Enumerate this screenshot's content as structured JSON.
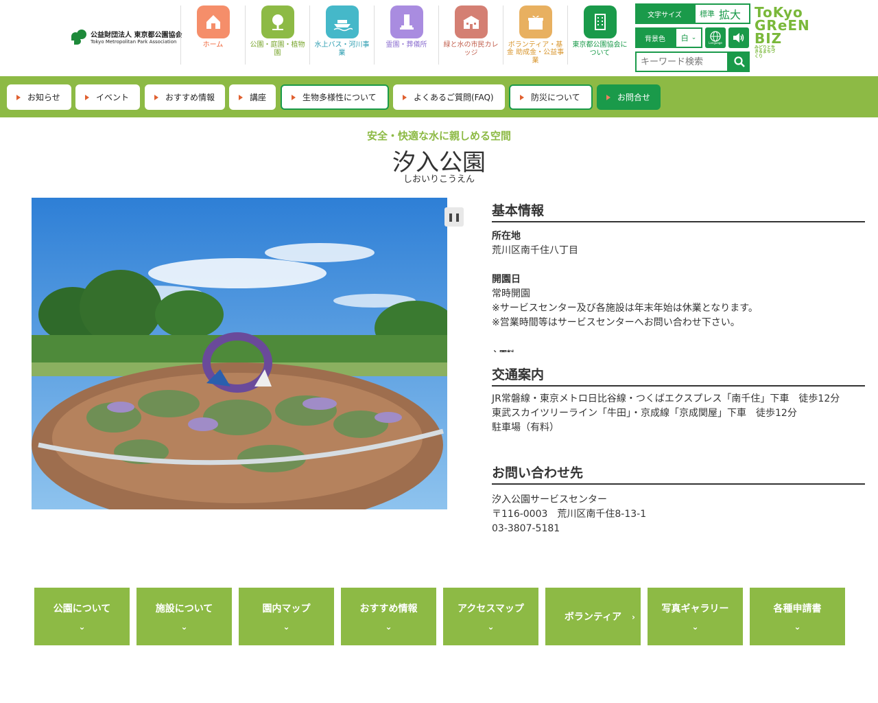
{
  "header": {
    "logo_line1": "公益財団法人 東京都公園協会",
    "logo_line2": "Tokyo Metropolitan Park Association",
    "nav": [
      {
        "label": "ホーム",
        "color": "#f58e6a",
        "text_color": "#f0683c",
        "icon": "home-icon"
      },
      {
        "label": "公園・庭園・植物園",
        "color": "#8dba45",
        "text_color": "#7aa62f",
        "icon": "tree-icon"
      },
      {
        "label": "水上バス・河川事業",
        "color": "#45b8c9",
        "text_color": "#2a9cb0",
        "icon": "boat-icon"
      },
      {
        "label": "霊園・葬儀所",
        "color": "#a98ce0",
        "text_color": "#8c6fd0",
        "icon": "monument-icon"
      },
      {
        "label": "緑と水の市民カレッジ",
        "color": "#d47f73",
        "text_color": "#c2604f",
        "icon": "school-icon"
      },
      {
        "label": "ボランティア・基金 助成金・公益事業",
        "color": "#e8b060",
        "text_color": "#d8952c",
        "icon": "gift-icon"
      },
      {
        "label": "東京都公園協会について",
        "color": "#1a9a4a",
        "text_color": "#1a9a4a",
        "icon": "building-icon"
      }
    ],
    "font_size_label": "文字サイズ",
    "font_size_standard": "標準",
    "font_size_large": "拡大",
    "bg_color_label": "背景色",
    "bg_color_value": "白",
    "language_label": "Language",
    "search_placeholder": "キーワード検索",
    "tgb_line1": "ToKyo",
    "tgb_line2": "GReEN",
    "tgb_line3": "BIZ",
    "tgb_small": "みどりと生きるまちづくり"
  },
  "menu": [
    {
      "label": "お知らせ"
    },
    {
      "label": "イベント"
    },
    {
      "label": "おすすめ情報"
    },
    {
      "label": "講座"
    },
    {
      "label": "生物多様性について"
    },
    {
      "label": "よくあるご質問(FAQ)"
    },
    {
      "label": "防災について"
    },
    {
      "label": "お問合せ"
    }
  ],
  "page": {
    "subtitle": "安全・快適な水に親しめる空間",
    "title": "汐入公園",
    "title_kana": "しおいりこうえん"
  },
  "info": {
    "basic_heading": "基本情報",
    "location_label": "所在地",
    "location_value": "荒川区南千住八丁目",
    "opening_label": "開園日",
    "opening_value": "常時開園",
    "opening_note1": "※サービスセンター及び各施設は年末年始は休業となります。",
    "opening_note2": "※営業時間等はサービスセンターへお問い合わせ下さい。",
    "fee_label_partial": "入園料",
    "access_heading": "交通案内",
    "access_line1": "JR常磐線・東京メトロ日比谷線・つくばエクスプレス「南千住」下車　徒歩12分",
    "access_line2": "東武スカイツリーライン「牛田」・京成線「京成関屋」下車　徒歩12分",
    "access_line3": "駐車場（有料）",
    "contact_heading": "お問い合わせ先",
    "contact_name": "汐入公園サービスセンター",
    "contact_address": "〒116-0003　荒川区南千住8-13-1",
    "contact_phone": "03-3807-5181"
  },
  "bottom_nav": [
    {
      "label": "公園について",
      "chevron": "down"
    },
    {
      "label": "施設について",
      "chevron": "down"
    },
    {
      "label": "園内マップ",
      "chevron": "down"
    },
    {
      "label": "おすすめ情報",
      "chevron": "down"
    },
    {
      "label": "アクセスマップ",
      "chevron": "down"
    },
    {
      "label": "ボランティア",
      "chevron": "right"
    },
    {
      "label": "写真ギャラリー",
      "chevron": "down"
    },
    {
      "label": "各種申請書",
      "chevron": "down"
    }
  ],
  "colors": {
    "brand_green": "#1a9a4a",
    "menu_green": "#8dba45",
    "accent_orange": "#e06030"
  }
}
